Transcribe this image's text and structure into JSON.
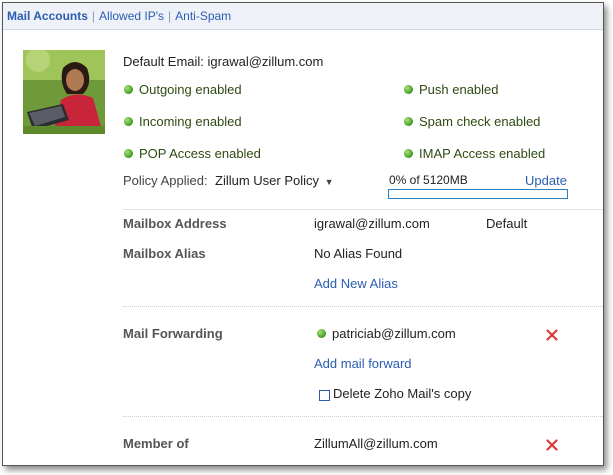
{
  "tabs": [
    {
      "label": "Mail Accounts"
    },
    {
      "label": "Allowed IP's"
    },
    {
      "label": "Anti-Spam"
    }
  ],
  "profile": {
    "default_email_label": "Default Email:",
    "default_email": "igrawal@zillum.com"
  },
  "status": {
    "outgoing": "Outgoing enabled",
    "push": "Push enabled",
    "incoming": "Incoming enabled",
    "spam": "Spam check enabled",
    "pop": "POP Access enabled",
    "imap": "IMAP Access enabled"
  },
  "policy": {
    "label": "Policy Applied:",
    "value": "Zillum User Policy",
    "usage_text": "0% of 5120MB",
    "usage_fraction": 0,
    "update_label": "Update"
  },
  "mailbox": {
    "address_label": "Mailbox Address",
    "address_value": "igrawal@zillum.com",
    "address_tag": "Default",
    "alias_label": "Mailbox Alias",
    "alias_value": "No Alias Found",
    "add_alias_label": "Add New Alias"
  },
  "forwarding": {
    "label": "Mail Forwarding",
    "email": "patriciab@zillum.com",
    "add_label": "Add mail forward",
    "delete_copy_label": "Delete Zoho Mail's copy",
    "delete_copy_checked": false
  },
  "member": {
    "label": "Member of",
    "group": "ZillumAll@zillum.com"
  },
  "colors": {
    "link": "#2a5db0",
    "status_green": "#3d9a1e",
    "remove_red": "#d83a3a",
    "progress": "#2a7fc0"
  }
}
